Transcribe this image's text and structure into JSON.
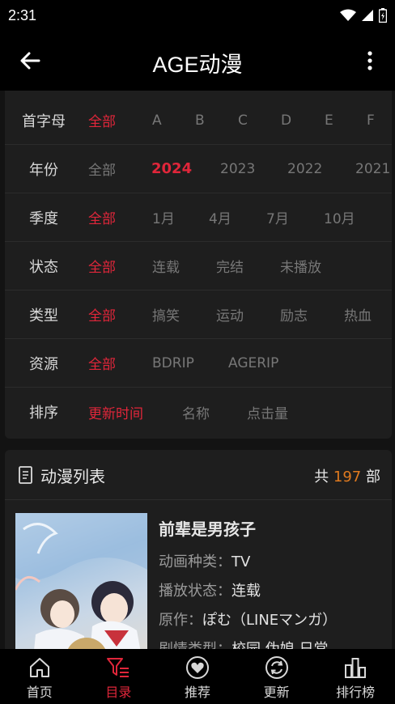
{
  "status": {
    "time": "2:31"
  },
  "appbar": {
    "title": "AGE动漫"
  },
  "filters": [
    {
      "label": "首字母",
      "options": [
        "全部",
        "A",
        "B",
        "C",
        "D",
        "E",
        "F"
      ],
      "active": 0
    },
    {
      "label": "年份",
      "options": [
        "全部",
        "2024",
        "2023",
        "2022",
        "2021"
      ],
      "active": 1
    },
    {
      "label": "季度",
      "options": [
        "全部",
        "1月",
        "4月",
        "7月",
        "10月"
      ],
      "active": 0
    },
    {
      "label": "状态",
      "options": [
        "全部",
        "连载",
        "完结",
        "未播放"
      ],
      "active": 0
    },
    {
      "label": "类型",
      "options": [
        "全部",
        "搞笑",
        "运动",
        "励志",
        "热血"
      ],
      "active": 0
    },
    {
      "label": "资源",
      "options": [
        "全部",
        "BDRIP",
        "AGERIP"
      ],
      "active": 0
    },
    {
      "label": "排序",
      "options": [
        "更新时间",
        "名称",
        "点击量"
      ],
      "active": 0
    }
  ],
  "list": {
    "title": "动漫列表",
    "count_prefix": "共 ",
    "count": "197",
    "count_suffix": " 部"
  },
  "item": {
    "name": "前辈是男孩子",
    "type_label": "动画种类：",
    "type_value": "TV",
    "status_label": "播放状态：",
    "status_value": "连载",
    "original_label": "原作：",
    "original_value": "ぽむ（LINEマンガ）",
    "genre_label": "剧情类型：",
    "genre_value": "校园 伪娘 日常"
  },
  "nav": [
    {
      "label": "首页",
      "icon": "home-icon"
    },
    {
      "label": "目录",
      "icon": "filter-list-icon"
    },
    {
      "label": "推荐",
      "icon": "heart-icon"
    },
    {
      "label": "更新",
      "icon": "refresh-icon"
    },
    {
      "label": "排行榜",
      "icon": "ranking-icon"
    }
  ],
  "nav_active": 1,
  "colors": {
    "accent": "#e0263a",
    "count": "#e07a1f",
    "background": "#131313",
    "card": "#1e1e1e"
  }
}
